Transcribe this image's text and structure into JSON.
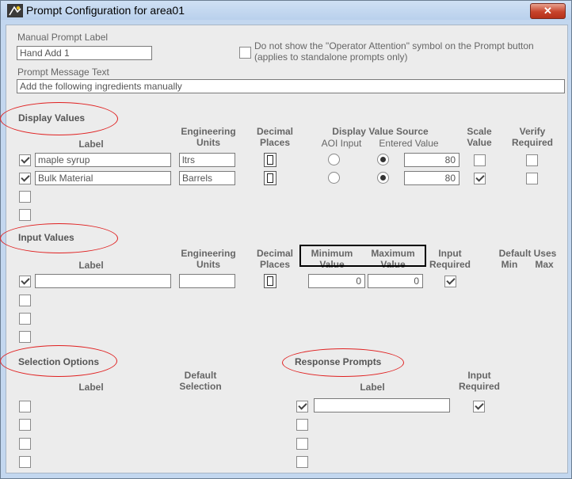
{
  "window": {
    "title": "Prompt Configuration for area01",
    "close_glyph": "✕"
  },
  "manual_prompt_label": {
    "label": "Manual Prompt Label",
    "value": "Hand Add 1"
  },
  "operator_attention": {
    "checked": false,
    "text_line1": "Do not show the \"Operator Attention\" symbol on the Prompt button",
    "text_line2": "(applies to standalone prompts only)"
  },
  "prompt_message": {
    "label": "Prompt Message Text",
    "value": "Add the following ingredients manually"
  },
  "display_values": {
    "title": "Display Values",
    "headers": {
      "label": "Label",
      "eng_units": "Engineering Units",
      "decimal_places": "Decimal Places",
      "source": "Display Value Source",
      "aoi_input": "AOI Input",
      "entered_value": "Entered Value",
      "scale_value": "Scale Value",
      "verify_required": "Verify Required"
    },
    "rows": [
      {
        "checked": true,
        "label": "maple syrup",
        "units": "ltrs",
        "source": "entered",
        "value": "80",
        "scale": false,
        "verify": false
      },
      {
        "checked": true,
        "label": "Bulk Material",
        "units": "Barrels",
        "source": "entered",
        "value": "80",
        "scale": true,
        "verify": false
      },
      {
        "checked": false
      },
      {
        "checked": false
      }
    ]
  },
  "input_values": {
    "title": "Input Values",
    "headers": {
      "label": "Label",
      "eng_units": "Engineering Units",
      "decimal_places": "Decimal Places",
      "minimum": "Minimum Value",
      "maximum": "Maximum Value",
      "input_required": "Input Required",
      "default_uses": "Default Uses",
      "min": "Min",
      "max": "Max"
    },
    "rows": [
      {
        "checked": true,
        "label": "",
        "units": "",
        "min": "0",
        "max": "0",
        "required": true
      },
      {
        "checked": false
      },
      {
        "checked": false
      },
      {
        "checked": false
      }
    ]
  },
  "selection_options": {
    "title": "Selection Options",
    "headers": {
      "label": "Label",
      "default_selection": "Default Selection"
    },
    "rows": [
      {
        "checked": false
      },
      {
        "checked": false
      },
      {
        "checked": false
      },
      {
        "checked": false
      }
    ]
  },
  "response_prompts": {
    "title": "Response Prompts",
    "headers": {
      "label": "Label",
      "input_required": "Input Required"
    },
    "rows": [
      {
        "checked": true,
        "label": "",
        "required": true
      },
      {
        "checked": false
      },
      {
        "checked": false
      },
      {
        "checked": false
      }
    ]
  },
  "colors": {
    "window_frame": "#c3d7ef",
    "client_bg": "#ececec",
    "annotation": "#e02020",
    "close_button": "#c7432b"
  }
}
